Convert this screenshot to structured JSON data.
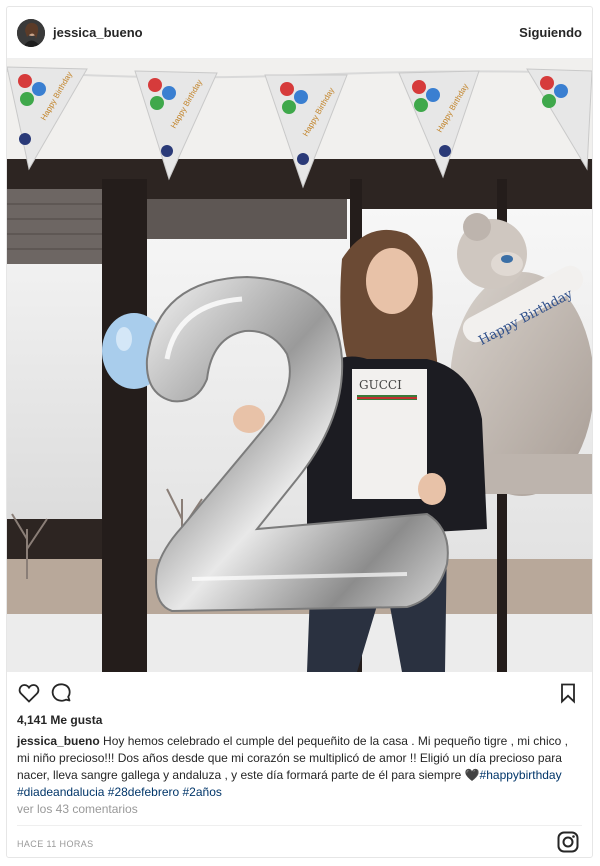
{
  "header": {
    "username": "jessica_bueno",
    "follow_status": "Siguiendo"
  },
  "photo": {
    "balloon_number": "2",
    "banner_text": "Happy Birthday",
    "bear_balloon_text": "Happy Birthday",
    "shirt_text": "GUCCI"
  },
  "actions": {
    "like_icon": "heart-icon",
    "comment_icon": "comment-icon",
    "save_icon": "bookmark-icon"
  },
  "likes": "4,141 Me gusta",
  "caption": {
    "user": "jessica_bueno",
    "text": " Hoy hemos celebrado el cumple del pequeñito de la casa . Mi pequeño tigre , mi chico , mi niño precioso!!! Dos años desde que mi corazón se multiplicó de amor !! Eligió un día precioso para nacer, lleva sangre gallega y andaluza , y este día formará parte de él para siempre ",
    "emoji": "🖤",
    "hashtags": [
      "#happybirthday",
      "#diadeandalucia",
      "#28defebrero",
      "#2años"
    ]
  },
  "comments_link": "ver los 43 comentarios",
  "timestamp": "HACE 11 HORAS",
  "colors": {
    "text": "#262626",
    "muted": "#999999",
    "hashtag": "#003569",
    "border": "#e6e6e6"
  }
}
